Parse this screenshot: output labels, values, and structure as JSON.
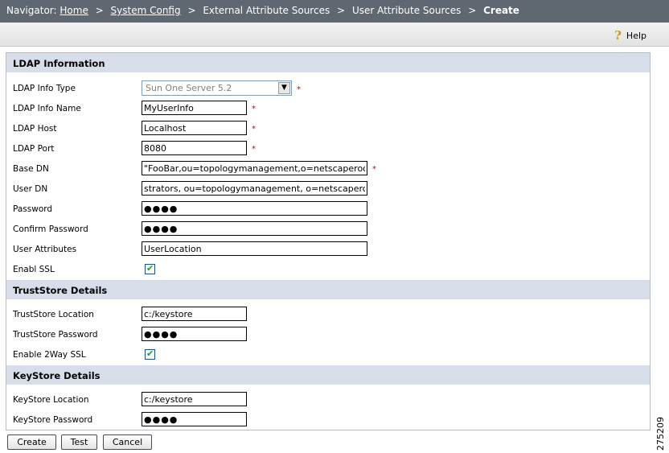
{
  "navigator": {
    "prefix": "Navigator:",
    "links": [
      "Home",
      "System Config"
    ],
    "crumbs": [
      "External Attribute Sources",
      "User Attribute Sources"
    ],
    "current": "Create",
    "separator": ">"
  },
  "toolbar": {
    "help_label": "Help",
    "help_icon": "question-mark-icon"
  },
  "sections": {
    "ldap": "LDAP Information",
    "truststore": "TrustStore Details",
    "keystore": "KeyStore Details"
  },
  "fields": {
    "ldap_info_type": {
      "label": "LDAP Info Type",
      "value": "Sun One Server 5.2"
    },
    "ldap_info_name": {
      "label": "LDAP Info Name",
      "value": "MyUserInfo"
    },
    "ldap_host": {
      "label": "LDAP Host",
      "value": "Localhost"
    },
    "ldap_port": {
      "label": "LDAP Port",
      "value": "8080"
    },
    "base_dn": {
      "label": "Base DN",
      "value": "\"FooBar,ou=topologymanagement,o=netscaperoot"
    },
    "user_dn": {
      "label": "User DN",
      "value": "strators, ou=topologymanagement, o=netscaperoot"
    },
    "password": {
      "label": "Password",
      "value": "●●●●"
    },
    "confirm_password": {
      "label": "Confirm Password",
      "value": "●●●●"
    },
    "user_attributes": {
      "label": "User Attributes",
      "value": "UserLocation"
    },
    "enable_ssl": {
      "label": "Enabl SSL",
      "checked": true
    },
    "truststore_location": {
      "label": "TrustStore Location",
      "value": "c:/keystore"
    },
    "truststore_password": {
      "label": "TrustStore Password",
      "value": "●●●●"
    },
    "enable_2way_ssl": {
      "label": "Enable 2Way SSL",
      "checked": true
    },
    "keystore_location": {
      "label": "KeyStore Location",
      "value": "c:/keystore"
    },
    "keystore_password": {
      "label": "KeyStore Password",
      "value": "●●●●"
    }
  },
  "required_mark": "*",
  "check_mark": "✔",
  "dropdown_arrow": "▼",
  "buttons": {
    "create": "Create",
    "test": "Test",
    "cancel": "Cancel"
  },
  "figure_id": "275209",
  "colors": {
    "nav_bg": "#5f6770",
    "section_bg": "#d7dde9",
    "required": "#cc0000",
    "check": "#21a121"
  }
}
